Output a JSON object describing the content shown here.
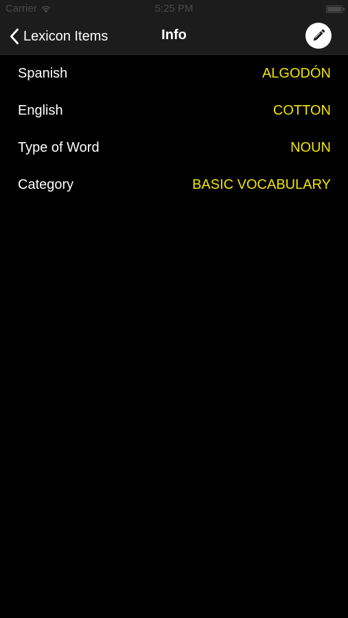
{
  "status_bar": {
    "carrier": "Carrier",
    "time": "5:25 PM"
  },
  "nav": {
    "back_label": "Lexicon Items",
    "title": "Info",
    "edit_icon": "pencil-icon"
  },
  "rows": [
    {
      "label": "Spanish",
      "value": "ALGODÓN"
    },
    {
      "label": "English",
      "value": "COTTON"
    },
    {
      "label": "Type of Word",
      "value": "NOUN"
    },
    {
      "label": "Category",
      "value": "BASIC VOCABULARY"
    }
  ],
  "colors": {
    "background": "#000000",
    "bar": "#1c1c1c",
    "accent_value": "#f2e500",
    "text": "#ffffff"
  }
}
